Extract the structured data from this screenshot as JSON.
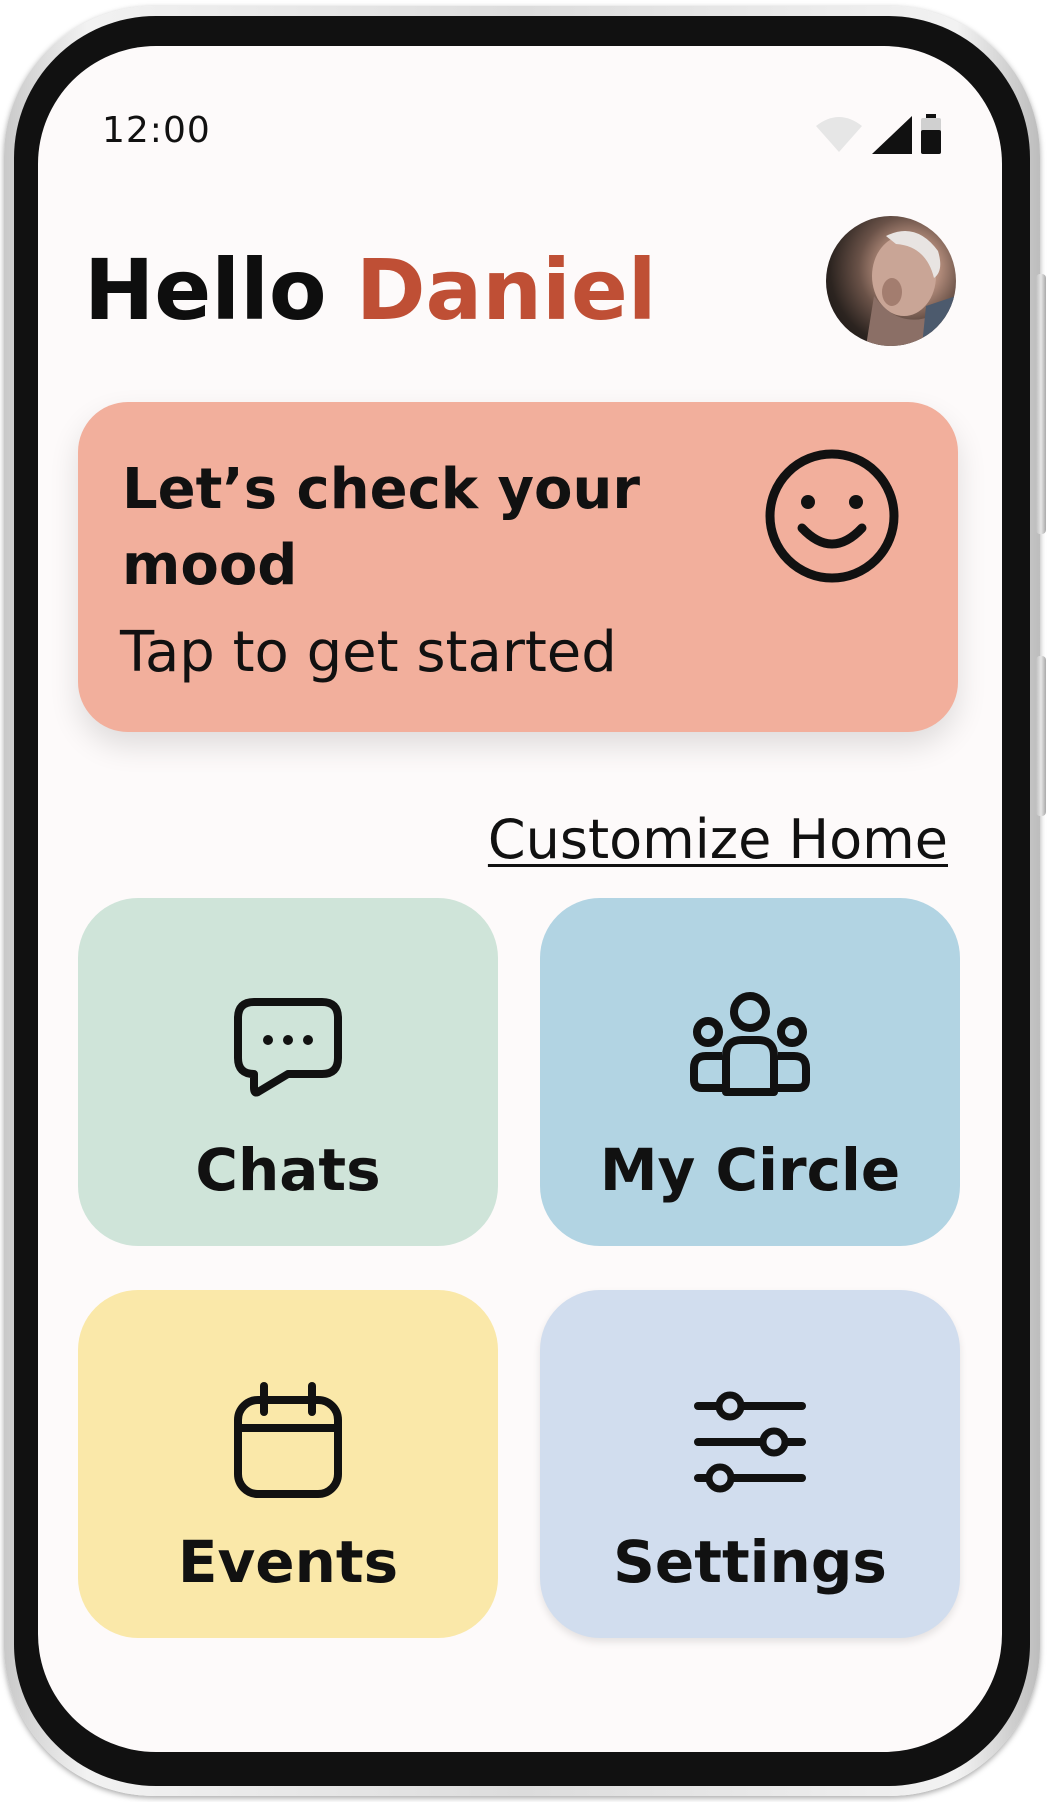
{
  "status_bar": {
    "time": "12:00",
    "icons": [
      "wifi-icon",
      "signal-icon",
      "battery-icon"
    ]
  },
  "greeting": {
    "hello": "Hello",
    "name": "Daniel"
  },
  "mood_card": {
    "title": "Let’s check your mood",
    "subtitle": "Tap to get started",
    "icon": "smiley-icon"
  },
  "customize_link": "Customize Home",
  "tiles": [
    {
      "label": "Chats",
      "icon": "chat-bubble-icon",
      "color": "#cfe4d9"
    },
    {
      "label": "My Circle",
      "icon": "group-icon",
      "color": "#b2d4e3"
    },
    {
      "label": "Events",
      "icon": "calendar-icon",
      "color": "#fae8a9"
    },
    {
      "label": "Settings",
      "icon": "sliders-icon",
      "color": "#d1ddee"
    }
  ],
  "colors": {
    "accent_name": "#bf4f35",
    "mood_card": "#f2af9c",
    "screen_background": "#fdfafa"
  }
}
